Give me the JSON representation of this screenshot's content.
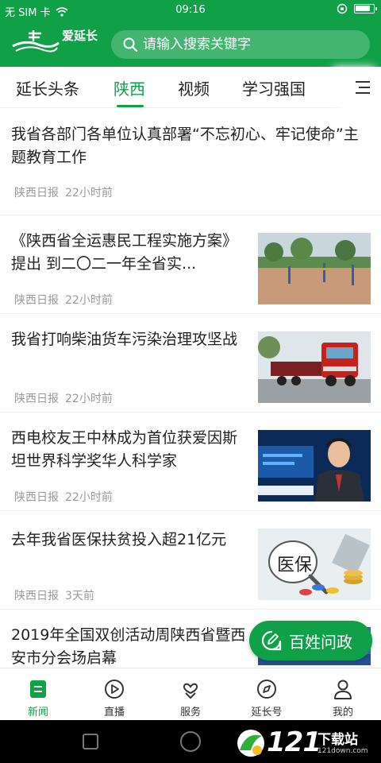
{
  "status_bar": {
    "carrier": "无 SIM 卡",
    "time": "09:16"
  },
  "header": {
    "logo_text": "爱延长",
    "search_placeholder": "请输入搜索关键字"
  },
  "tabs": [
    {
      "label": "延长头条",
      "active": false
    },
    {
      "label": "陕西",
      "active": true
    },
    {
      "label": "视频",
      "active": false
    },
    {
      "label": "学习强国",
      "active": false
    }
  ],
  "news": [
    {
      "title": "我省各部门各单位认真部署“不忘初心、牢记使命”主题教育工作",
      "source": "陕西日报",
      "time": "22小时前",
      "thumb": null
    },
    {
      "title": "《陕西省全运惠民工程实施方案》提出 到二〇二一年全省实...",
      "source": "陕西日报",
      "time": "22小时前",
      "thumb": "fitness-park-image"
    },
    {
      "title": "我省打响柴油货车污染治理攻坚战",
      "source": "陕西日报",
      "time": "22小时前",
      "thumb": "red-truck-image"
    },
    {
      "title": "西电校友王中林成为首位获爱因斯坦世界科学奖华人科学家",
      "source": "陕西日报",
      "time": "22小时前",
      "thumb": "scientist-tv-image"
    },
    {
      "title": "去年我省医保扶贫投入超21亿元",
      "source": "陕西日报",
      "time": "3天前",
      "thumb": "medical-insurance-image",
      "thumb_text": "医保"
    },
    {
      "title": "2019年全国双创活动周陕西省暨西安市分会场启幕",
      "source": "",
      "time": "",
      "thumb": "event-banner-image"
    }
  ],
  "fab": {
    "label": "百姓问政"
  },
  "bottom_nav": [
    {
      "label": "新闻",
      "icon": "news-icon",
      "active": true
    },
    {
      "label": "直播",
      "icon": "play-icon",
      "active": false
    },
    {
      "label": "服务",
      "icon": "heart-hands-icon",
      "active": false
    },
    {
      "label": "延长号",
      "icon": "compass-icon",
      "active": false
    },
    {
      "label": "我的",
      "icon": "person-icon",
      "active": false
    }
  ],
  "watermark": {
    "number": "121",
    "text": "下载站",
    "url": "121down.com"
  },
  "colors": {
    "brand_green": "#0fa048",
    "meta_gray": "#999999"
  }
}
